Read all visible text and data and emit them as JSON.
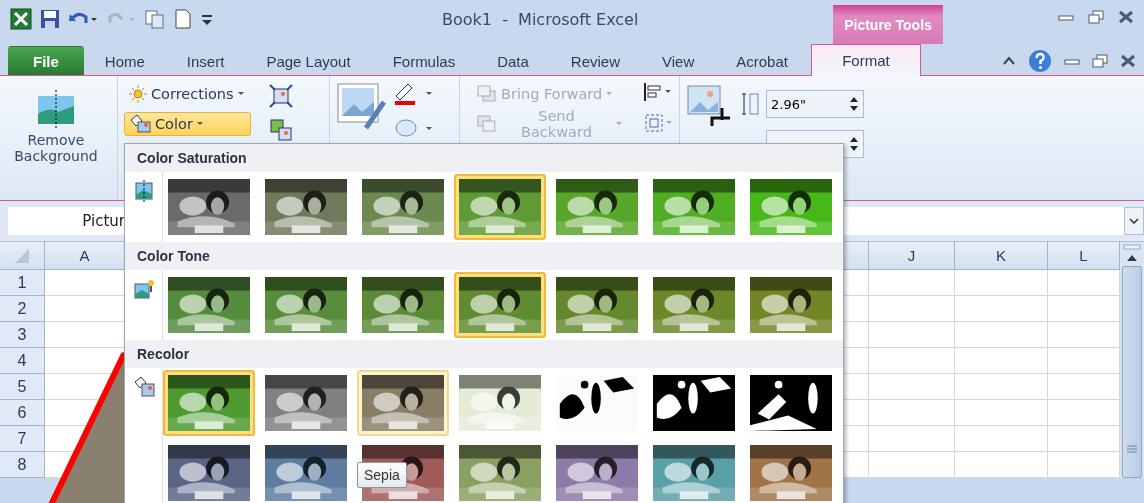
{
  "title_bar": {
    "title": "Book1  -  Microsoft Excel",
    "context_tab": "Picture Tools"
  },
  "tabs": [
    {
      "label": "File",
      "kind": "file",
      "selected": false
    },
    {
      "label": "Home",
      "kind": "tab",
      "selected": false
    },
    {
      "label": "Insert",
      "kind": "tab",
      "selected": false
    },
    {
      "label": "Page Layout",
      "kind": "tab",
      "selected": false
    },
    {
      "label": "Formulas",
      "kind": "tab",
      "selected": false
    },
    {
      "label": "Data",
      "kind": "tab",
      "selected": false
    },
    {
      "label": "Review",
      "kind": "tab",
      "selected": false
    },
    {
      "label": "View",
      "kind": "tab",
      "selected": false
    },
    {
      "label": "Acrobat",
      "kind": "tab",
      "selected": false
    },
    {
      "label": "Format",
      "kind": "tab",
      "selected": true
    }
  ],
  "ribbon": {
    "remove_background": "Remove Background",
    "corrections": {
      "label": "Corrections",
      "pressed": false
    },
    "color": {
      "label": "Color",
      "pressed": true
    },
    "bring_forward": {
      "label": "Bring Forward",
      "disabled": true
    },
    "send_backward": {
      "label": "Send Backward",
      "disabled": true
    },
    "height_field": {
      "value": "2.96\""
    }
  },
  "name_box": {
    "value": "Pictur"
  },
  "grid": {
    "columns_left": [
      "A"
    ],
    "columns_right": [
      "J",
      "K",
      "L"
    ],
    "rows": [
      "1",
      "2",
      "3",
      "4",
      "5",
      "6",
      "7",
      "8"
    ]
  },
  "menu": {
    "sections": [
      {
        "title": "Color Saturation",
        "rows": [
          [
            {
              "kind": "picture",
              "color": "#6a6a6a",
              "selected": false,
              "hovered": false
            },
            {
              "kind": "picture",
              "color": "#6f7a5c",
              "selected": false,
              "hovered": false
            },
            {
              "kind": "picture",
              "color": "#6c8a50",
              "selected": false,
              "hovered": false
            },
            {
              "kind": "picture",
              "color": "#5f9a35",
              "selected": true,
              "hovered": false
            },
            {
              "kind": "picture",
              "color": "#58a62a",
              "selected": false,
              "hovered": false
            },
            {
              "kind": "picture",
              "color": "#4fae22",
              "selected": false,
              "hovered": false
            },
            {
              "kind": "picture",
              "color": "#48b818",
              "selected": false,
              "hovered": false
            }
          ]
        ]
      },
      {
        "title": "Color Tone",
        "rows": [
          [
            {
              "kind": "picture",
              "color": "#548c3e",
              "selected": false,
              "hovered": false
            },
            {
              "kind": "picture",
              "color": "#588c3a",
              "selected": false,
              "hovered": false
            },
            {
              "kind": "picture",
              "color": "#5c8a36",
              "selected": false,
              "hovered": false
            },
            {
              "kind": "picture",
              "color": "#5f8c30",
              "selected": true,
              "hovered": false
            },
            {
              "kind": "picture",
              "color": "#64892c",
              "selected": false,
              "hovered": false
            },
            {
              "kind": "picture",
              "color": "#6a8828",
              "selected": false,
              "hovered": false
            },
            {
              "kind": "picture",
              "color": "#728626",
              "selected": false,
              "hovered": false
            }
          ]
        ]
      },
      {
        "title": "Recolor",
        "rows": [
          [
            {
              "kind": "picture",
              "color": "#4f9a30",
              "selected": true,
              "hovered": false
            },
            {
              "kind": "picture",
              "color": "#808080",
              "selected": false,
              "hovered": false
            },
            {
              "kind": "picture",
              "color": "#8a7d66",
              "selected": false,
              "hovered": true
            },
            {
              "kind": "picture",
              "color": "#e4ecd8",
              "selected": false,
              "hovered": false
            },
            {
              "kind": "picture",
              "color": "#fbfbfb",
              "selected": false,
              "hovered": false
            },
            {
              "kind": "picture",
              "color": "#000000",
              "selected": false,
              "hovered": false
            },
            {
              "kind": "picture",
              "color": "#010101",
              "selected": false,
              "hovered": false
            }
          ],
          [
            {
              "kind": "picture",
              "color": "#5a6585",
              "selected": false,
              "hovered": false
            },
            {
              "kind": "picture",
              "color": "#5d7ca0",
              "selected": false,
              "hovered": false
            },
            {
              "kind": "picture",
              "color": "#a05a58",
              "selected": false,
              "hovered": false
            },
            {
              "kind": "picture",
              "color": "#8aa060",
              "selected": false,
              "hovered": false
            },
            {
              "kind": "picture",
              "color": "#8d7aa8",
              "selected": false,
              "hovered": false
            },
            {
              "kind": "picture",
              "color": "#5aa0a8",
              "selected": false,
              "hovered": false
            },
            {
              "kind": "picture",
              "color": "#a07448",
              "selected": false,
              "hovered": false
            }
          ]
        ]
      }
    ],
    "tooltip": "Sepia"
  }
}
